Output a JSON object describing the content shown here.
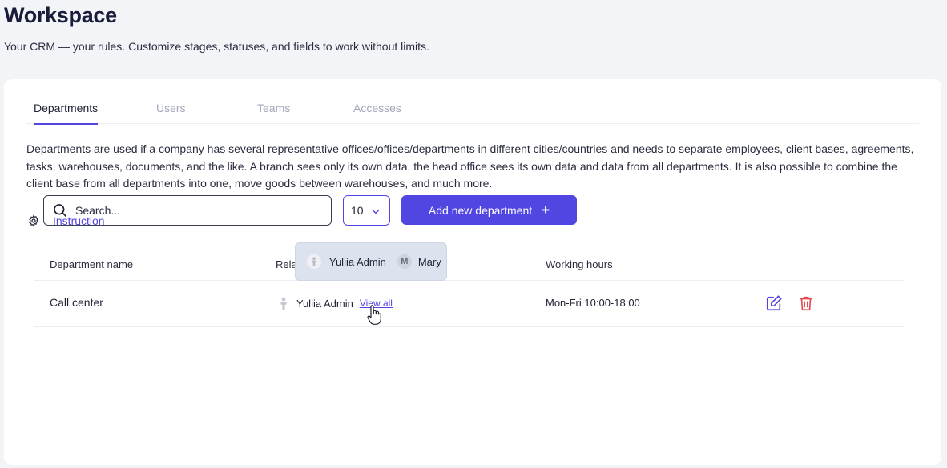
{
  "page": {
    "title": "Workspace",
    "subtitle": "Your CRM — your rules. Customize stages, statuses, and fields to work without limits."
  },
  "tabs": [
    {
      "label": "Departments",
      "active": true
    },
    {
      "label": "Users",
      "active": false
    },
    {
      "label": "Teams",
      "active": false
    },
    {
      "label": "Accesses",
      "active": false
    }
  ],
  "description": "Departments are used if a company has several representative offices/offices/departments in different cities/countries and needs to separate employees, client bases, agreements, tasks, warehouses, documents, and the like. A branch sees only its own data, the head office sees its own data and data from all departments. It is also possible to combine the client base from all departments into one, move goods between warehouses, and much more.",
  "instruction": {
    "label": "Instruction",
    "icon": "gear-icon"
  },
  "toolbar": {
    "search_placeholder": "Search...",
    "search_value": "",
    "per_page": "10",
    "add_label": "Add new department",
    "add_icon": "+"
  },
  "table": {
    "headers": {
      "name": "Department name",
      "responsible": "Relat",
      "hours": "Working hours"
    },
    "rows": [
      {
        "name": "Call center",
        "responsible": "Yuliia Admin",
        "view_all": "View all",
        "hours": "Mon-Fri 10:00-18:00"
      }
    ]
  },
  "tooltip": {
    "users": [
      {
        "name": "Yuliia Admin",
        "avatar": "person-icon"
      },
      {
        "name": "Mary",
        "avatar": "M"
      }
    ]
  },
  "colors": {
    "accent": "#5146e1",
    "danger": "#e5484d",
    "background": "#f3f4f8"
  }
}
